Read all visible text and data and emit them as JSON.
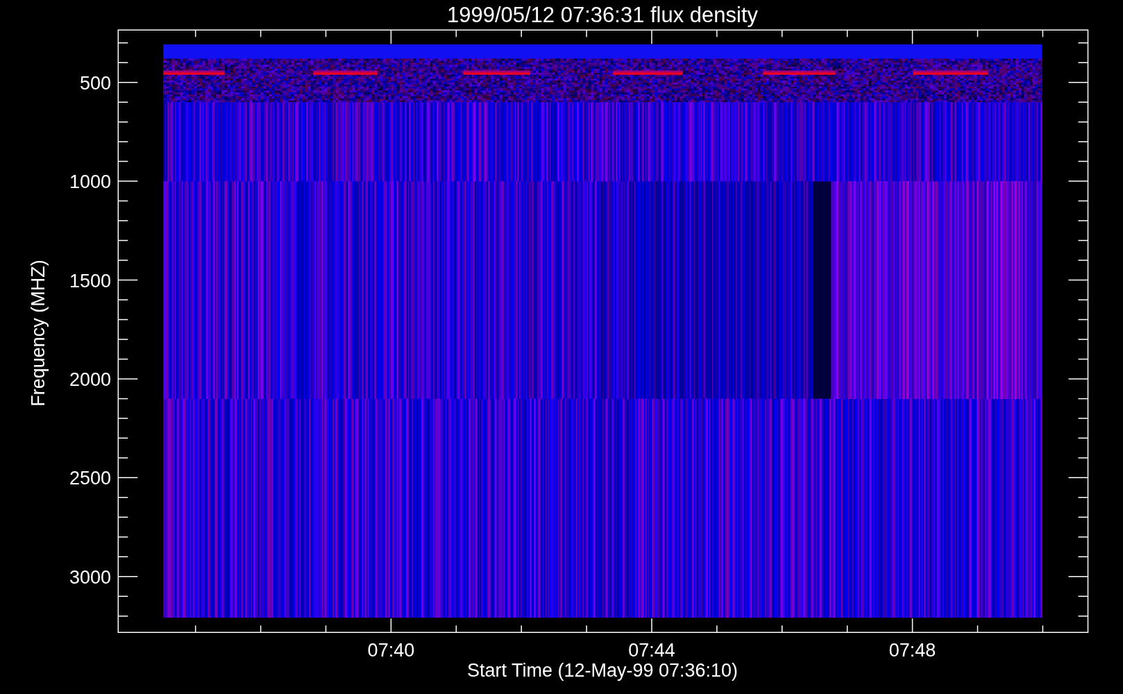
{
  "title": "1999/05/12 07:36:31 flux density",
  "y_axis": {
    "label": "Frequency (MHZ)",
    "ticks": [
      "500",
      "1000",
      "1500",
      "2000",
      "2500",
      "3000"
    ]
  },
  "x_axis": {
    "label": "Start Time (12-May-99 07:36:10)",
    "ticks": [
      "07:40",
      "07:44",
      "07:48"
    ]
  }
}
